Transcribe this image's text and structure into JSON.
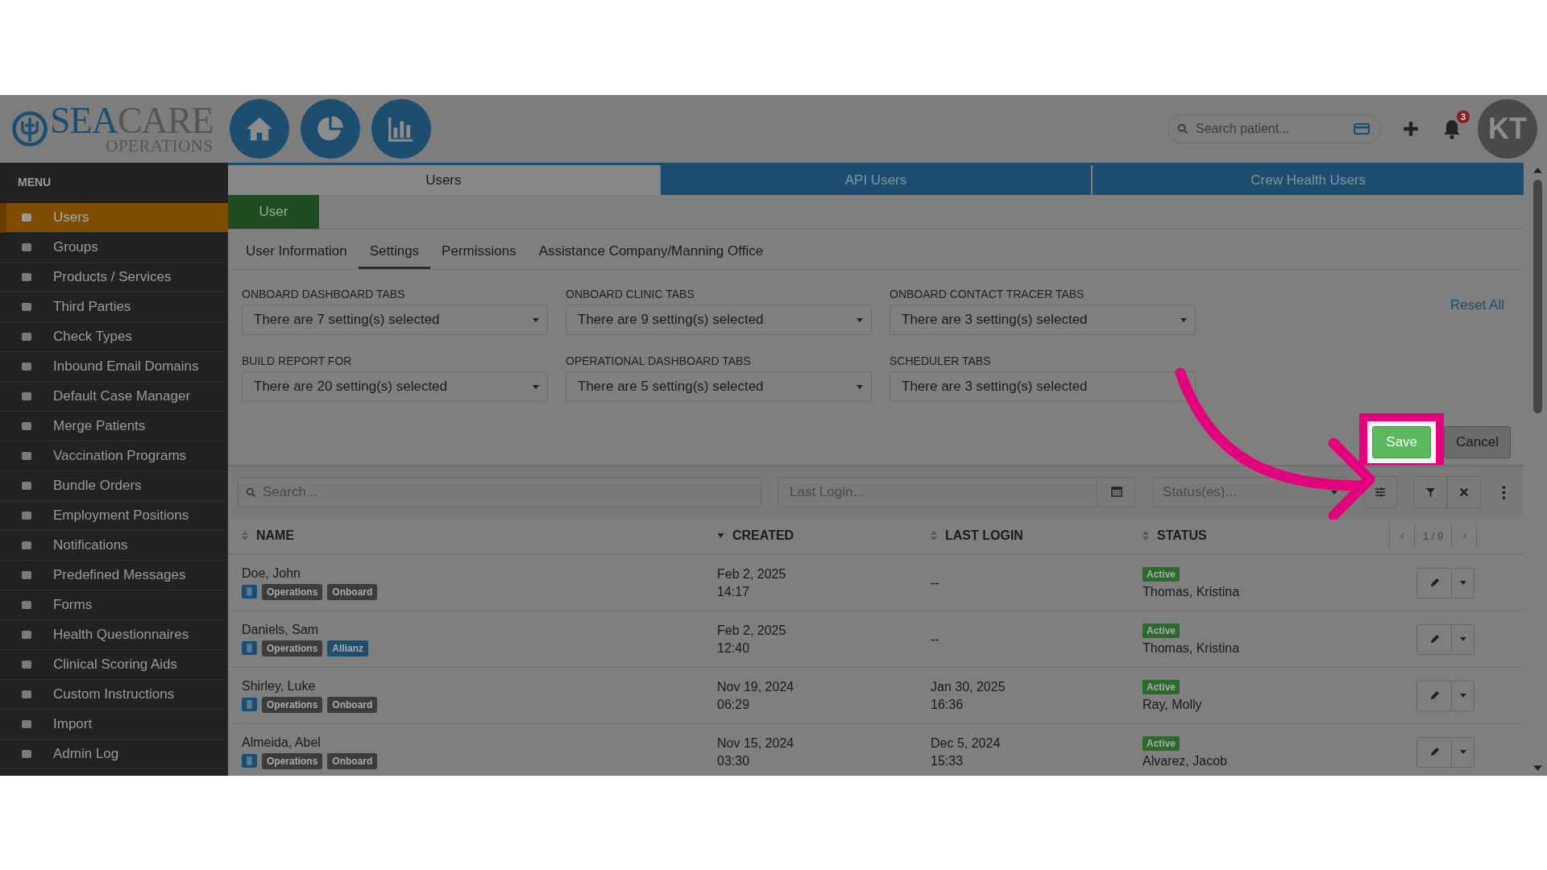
{
  "header": {
    "logo": {
      "main_a": "SEA",
      "main_b": "CARE",
      "sub": "OPERATIONS"
    },
    "search": {
      "placeholder": "Search patient..."
    },
    "notifications": {
      "count": "3"
    },
    "avatar": {
      "initials": "KT"
    }
  },
  "sidebar": {
    "title": "MENU",
    "items": [
      {
        "label": "Users",
        "selected": true
      },
      {
        "label": "Groups",
        "selected": false
      },
      {
        "label": "Products / Services",
        "selected": false
      },
      {
        "label": "Third Parties",
        "selected": false
      },
      {
        "label": "Check Types",
        "selected": false
      },
      {
        "label": "Inbound Email Domains",
        "selected": false
      },
      {
        "label": "Default Case Manager",
        "selected": false
      },
      {
        "label": "Merge Patients",
        "selected": false
      },
      {
        "label": "Vaccination Programs",
        "selected": false
      },
      {
        "label": "Bundle Orders",
        "selected": false
      },
      {
        "label": "Employment Positions",
        "selected": false
      },
      {
        "label": "Notifications",
        "selected": false
      },
      {
        "label": "Predefined Messages",
        "selected": false
      },
      {
        "label": "Forms",
        "selected": false
      },
      {
        "label": "Health Questionnaires",
        "selected": false
      },
      {
        "label": "Clinical Scoring Aids",
        "selected": false
      },
      {
        "label": "Custom Instructions",
        "selected": false
      },
      {
        "label": "Import",
        "selected": false
      },
      {
        "label": "Admin Log",
        "selected": false
      }
    ]
  },
  "tabs": [
    {
      "label": "Users",
      "selected": true
    },
    {
      "label": "API Users",
      "selected": false
    },
    {
      "label": "Crew Health Users",
      "selected": false
    }
  ],
  "user_button": "User",
  "subtabs": [
    {
      "label": "User Information",
      "selected": false
    },
    {
      "label": "Settings",
      "selected": true
    },
    {
      "label": "Permissions",
      "selected": false
    },
    {
      "label": "Assistance Company/Manning Office",
      "selected": false
    }
  ],
  "settings": [
    {
      "label": "ONBOARD DASHBOARD TABS",
      "value": "There are 7 setting(s) selected"
    },
    {
      "label": "ONBOARD CLINIC TABS",
      "value": "There are 9 setting(s) selected"
    },
    {
      "label": "ONBOARD CONTACT TRACER TABS",
      "value": "There are 3 setting(s) selected"
    },
    {
      "label": "BUILD REPORT FOR",
      "value": "There are 20 setting(s) selected"
    },
    {
      "label": "OPERATIONAL DASHBOARD TABS",
      "value": "There are 5 setting(s) selected"
    },
    {
      "label": "SCHEDULER TABS",
      "value": "There are 3 setting(s) selected"
    }
  ],
  "reset_all": "Reset All",
  "save": "Save",
  "cancel": "Cancel",
  "filters": {
    "search": {
      "placeholder": "Search..."
    },
    "last_login": {
      "placeholder": "Last Login..."
    },
    "status": {
      "placeholder": "Status(es)..."
    }
  },
  "table": {
    "columns": [
      {
        "label": "NAME",
        "sorted": false
      },
      {
        "label": "CREATED",
        "sorted": true
      },
      {
        "label": "LAST LOGIN",
        "sorted": false
      },
      {
        "label": "STATUS",
        "sorted": false
      }
    ],
    "pagination": "1 / 9",
    "rows": [
      {
        "name": "Doe, John",
        "tags": [
          {
            "label": "Operations",
            "color": "#3c3c3c"
          },
          {
            "label": "Onboard",
            "color": "#3c3c3c"
          }
        ],
        "created": [
          "Feb 2, 2025",
          "14:17"
        ],
        "last_login": [
          "--"
        ],
        "status": "Active",
        "manager": "Thomas, Kristina"
      },
      {
        "name": "Daniels, Sam",
        "tags": [
          {
            "label": "Operations",
            "color": "#3c3c3c"
          },
          {
            "label": "Allianz",
            "color": "#1d4e70"
          }
        ],
        "created": [
          "Feb 2, 2025",
          "12:40"
        ],
        "last_login": [
          "--"
        ],
        "status": "Active",
        "manager": "Thomas, Kristina"
      },
      {
        "name": "Shirley, Luke",
        "tags": [
          {
            "label": "Operations",
            "color": "#3c3c3c"
          },
          {
            "label": "Onboard",
            "color": "#3c3c3c"
          }
        ],
        "created": [
          "Nov 19, 2024",
          "06:29"
        ],
        "last_login": [
          "Jan 30, 2025",
          "16:36"
        ],
        "status": "Active",
        "manager": "Ray, Molly"
      },
      {
        "name": "Almeida, Abel",
        "tags": [
          {
            "label": "Operations",
            "color": "#3c3c3c"
          },
          {
            "label": "Onboard",
            "color": "#3c3c3c"
          }
        ],
        "created": [
          "Nov 15, 2024",
          "03:30"
        ],
        "last_login": [
          "Dec 5, 2024",
          "15:33"
        ],
        "status": "Active",
        "manager": "Alvarez, Jacob"
      }
    ]
  }
}
